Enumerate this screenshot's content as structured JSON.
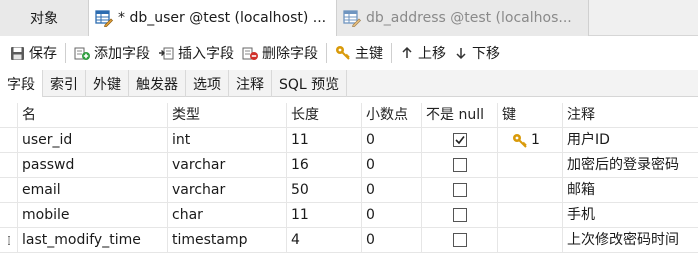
{
  "doc_tabs": [
    {
      "label": "对象"
    },
    {
      "label": "* db_user @test (localhost) ..."
    },
    {
      "label": "db_address @test (localhos..."
    }
  ],
  "toolbar": {
    "save": "保存",
    "add_field": "添加字段",
    "insert_field": "插入字段",
    "delete_field": "删除字段",
    "primary_key": "主键",
    "move_up": "上移",
    "move_down": "下移"
  },
  "sub_tabs": [
    {
      "label": "字段"
    },
    {
      "label": "索引"
    },
    {
      "label": "外键"
    },
    {
      "label": "触发器"
    },
    {
      "label": "选项"
    },
    {
      "label": "注释"
    },
    {
      "label": "SQL 预览"
    }
  ],
  "grid": {
    "headers": {
      "name": "名",
      "type": "类型",
      "length": "长度",
      "decimals": "小数点",
      "not_null": "不是 null",
      "key": "键",
      "comment": "注释"
    },
    "rows": [
      {
        "name": "user_id",
        "type": "int",
        "length": "11",
        "decimals": "0",
        "not_null": true,
        "key": "1",
        "comment": "用户ID"
      },
      {
        "name": "passwd",
        "type": "varchar",
        "length": "16",
        "decimals": "0",
        "not_null": false,
        "key": "",
        "comment": "加密后的登录密码"
      },
      {
        "name": "email",
        "type": "varchar",
        "length": "50",
        "decimals": "0",
        "not_null": false,
        "key": "",
        "comment": "邮箱"
      },
      {
        "name": "mobile",
        "type": "char",
        "length": "11",
        "decimals": "0",
        "not_null": false,
        "key": "",
        "comment": "手机"
      },
      {
        "name": "last_modify_time",
        "type": "timestamp",
        "length": "4",
        "decimals": "0",
        "not_null": false,
        "key": "",
        "comment": "上次修改密码时间"
      }
    ]
  },
  "colors": {
    "tab_bar": "#f0f0f0",
    "key_gold": "#d99a0a",
    "delete_red": "#d0302a",
    "add_green": "#2f9d3f"
  }
}
